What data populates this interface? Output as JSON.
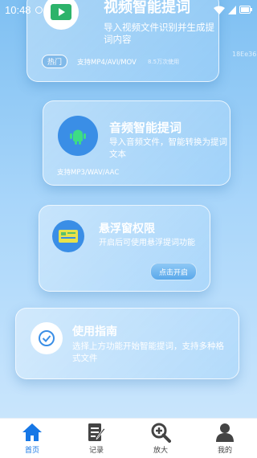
{
  "status": {
    "time": "10:48"
  },
  "cards": {
    "video": {
      "title": "视频智能提词",
      "desc": "导入视频文件识别并生成提词内容",
      "badge": "热门",
      "formats": "支持MP4/AVI/MOV",
      "usage": "8.5万次使用",
      "icon": "play-video-icon"
    },
    "audio": {
      "title": "音频智能提词",
      "desc": "导入音频文件，智能转换为提词文本",
      "formats": "支持MP3/WAV/AAC",
      "icon": "android-robot-icon"
    },
    "float": {
      "title": "悬浮窗权限",
      "desc": "开启后可使用悬浮提词功能",
      "button": "点击开启",
      "icon": "floating-window-icon"
    },
    "guide": {
      "title": "使用指南",
      "desc": "选择上方功能开始智能提词，支持多种格式文件",
      "icon": "check-circle-icon"
    }
  },
  "watermark": "18Ee36",
  "tabs": [
    {
      "label": "首页",
      "icon": "home-icon",
      "active": true
    },
    {
      "label": "记录",
      "icon": "record-edit-icon",
      "active": false
    },
    {
      "label": "放大",
      "icon": "zoom-in-icon",
      "active": false
    },
    {
      "label": "我的",
      "icon": "user-icon",
      "active": false
    }
  ],
  "colors": {
    "accent": "#1677e6",
    "icon_bg": "#3a8ee6",
    "video_green": "#2db36a"
  }
}
